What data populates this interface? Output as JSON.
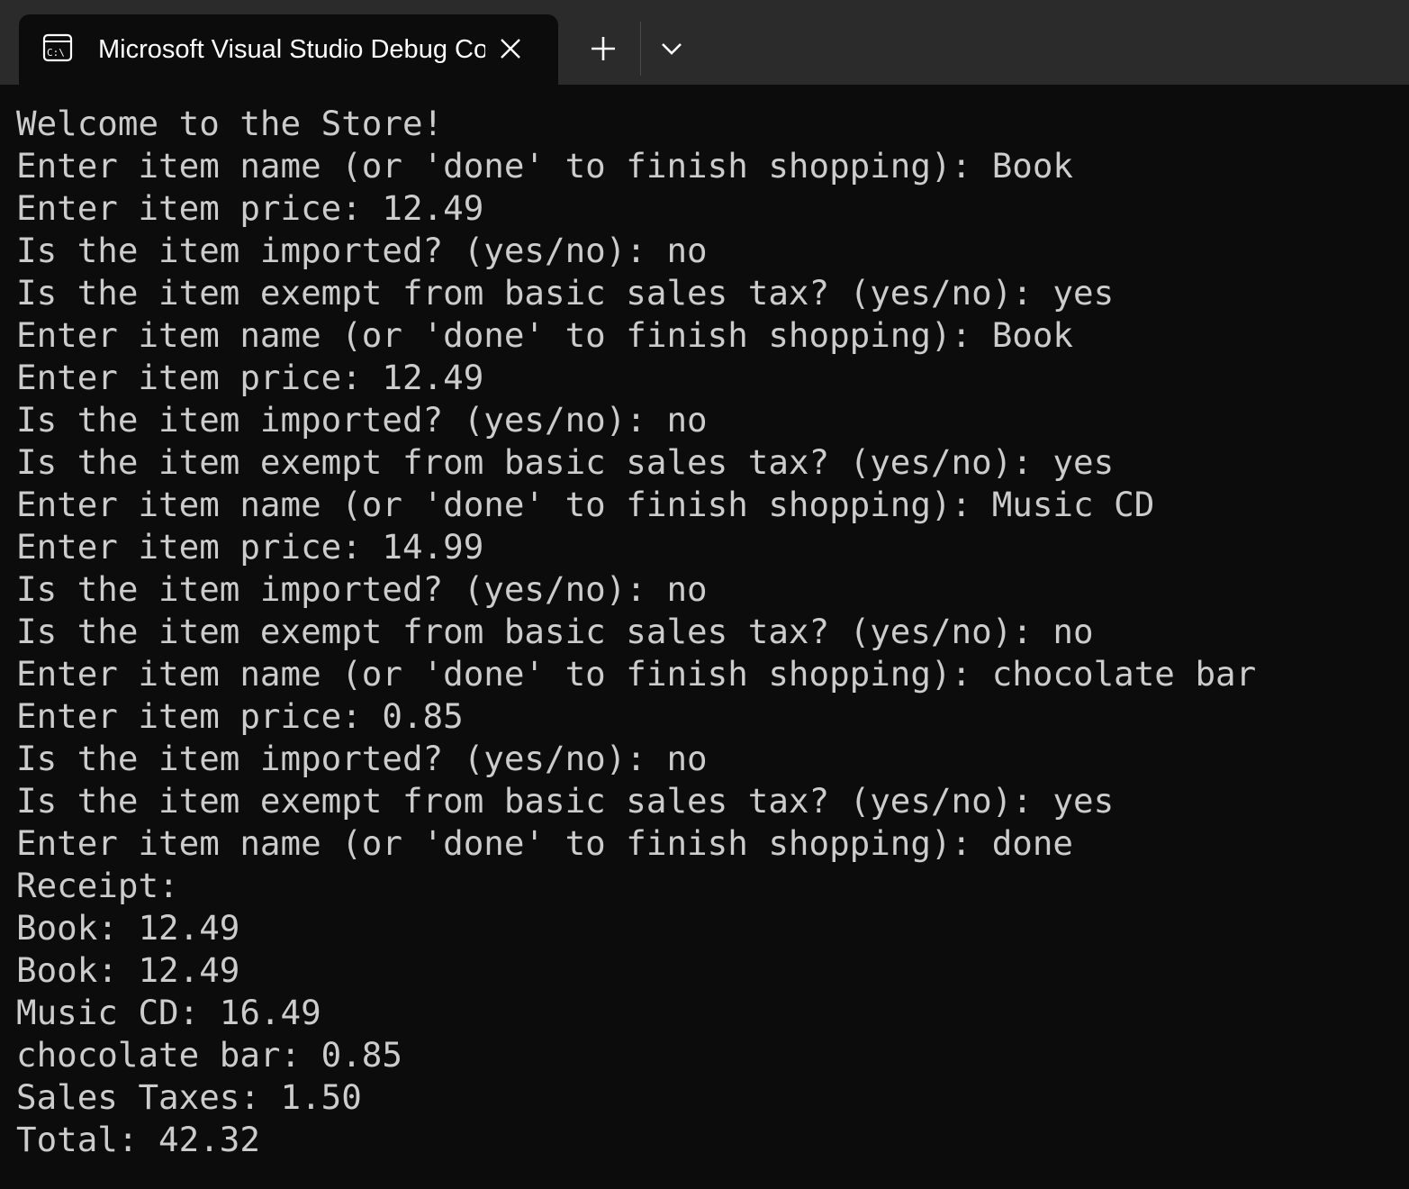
{
  "window": {
    "tab_title": "Microsoft Visual Studio Debug Console",
    "tab_icon": "console-icon",
    "close_icon": "close-icon",
    "new_tab_icon": "plus-icon",
    "dropdown_icon": "chevron-down-icon"
  },
  "console": {
    "lines": [
      "Welcome to the Store!",
      "Enter item name (or 'done' to finish shopping): Book",
      "Enter item price: 12.49",
      "Is the item imported? (yes/no): no",
      "Is the item exempt from basic sales tax? (yes/no): yes",
      "Enter item name (or 'done' to finish shopping): Book",
      "Enter item price: 12.49",
      "Is the item imported? (yes/no): no",
      "Is the item exempt from basic sales tax? (yes/no): yes",
      "Enter item name (or 'done' to finish shopping): Music CD",
      "Enter item price: 14.99",
      "Is the item imported? (yes/no): no",
      "Is the item exempt from basic sales tax? (yes/no): no",
      "Enter item name (or 'done' to finish shopping): chocolate bar",
      "Enter item price: 0.85",
      "Is the item imported? (yes/no): no",
      "Is the item exempt from basic sales tax? (yes/no): yes",
      "Enter item name (or 'done' to finish shopping): done",
      "Receipt:",
      "Book: 12.49",
      "Book: 12.49",
      "Music CD: 16.49",
      "chocolate bar: 0.85",
      "Sales Taxes: 1.50",
      "Total: 42.32"
    ]
  }
}
